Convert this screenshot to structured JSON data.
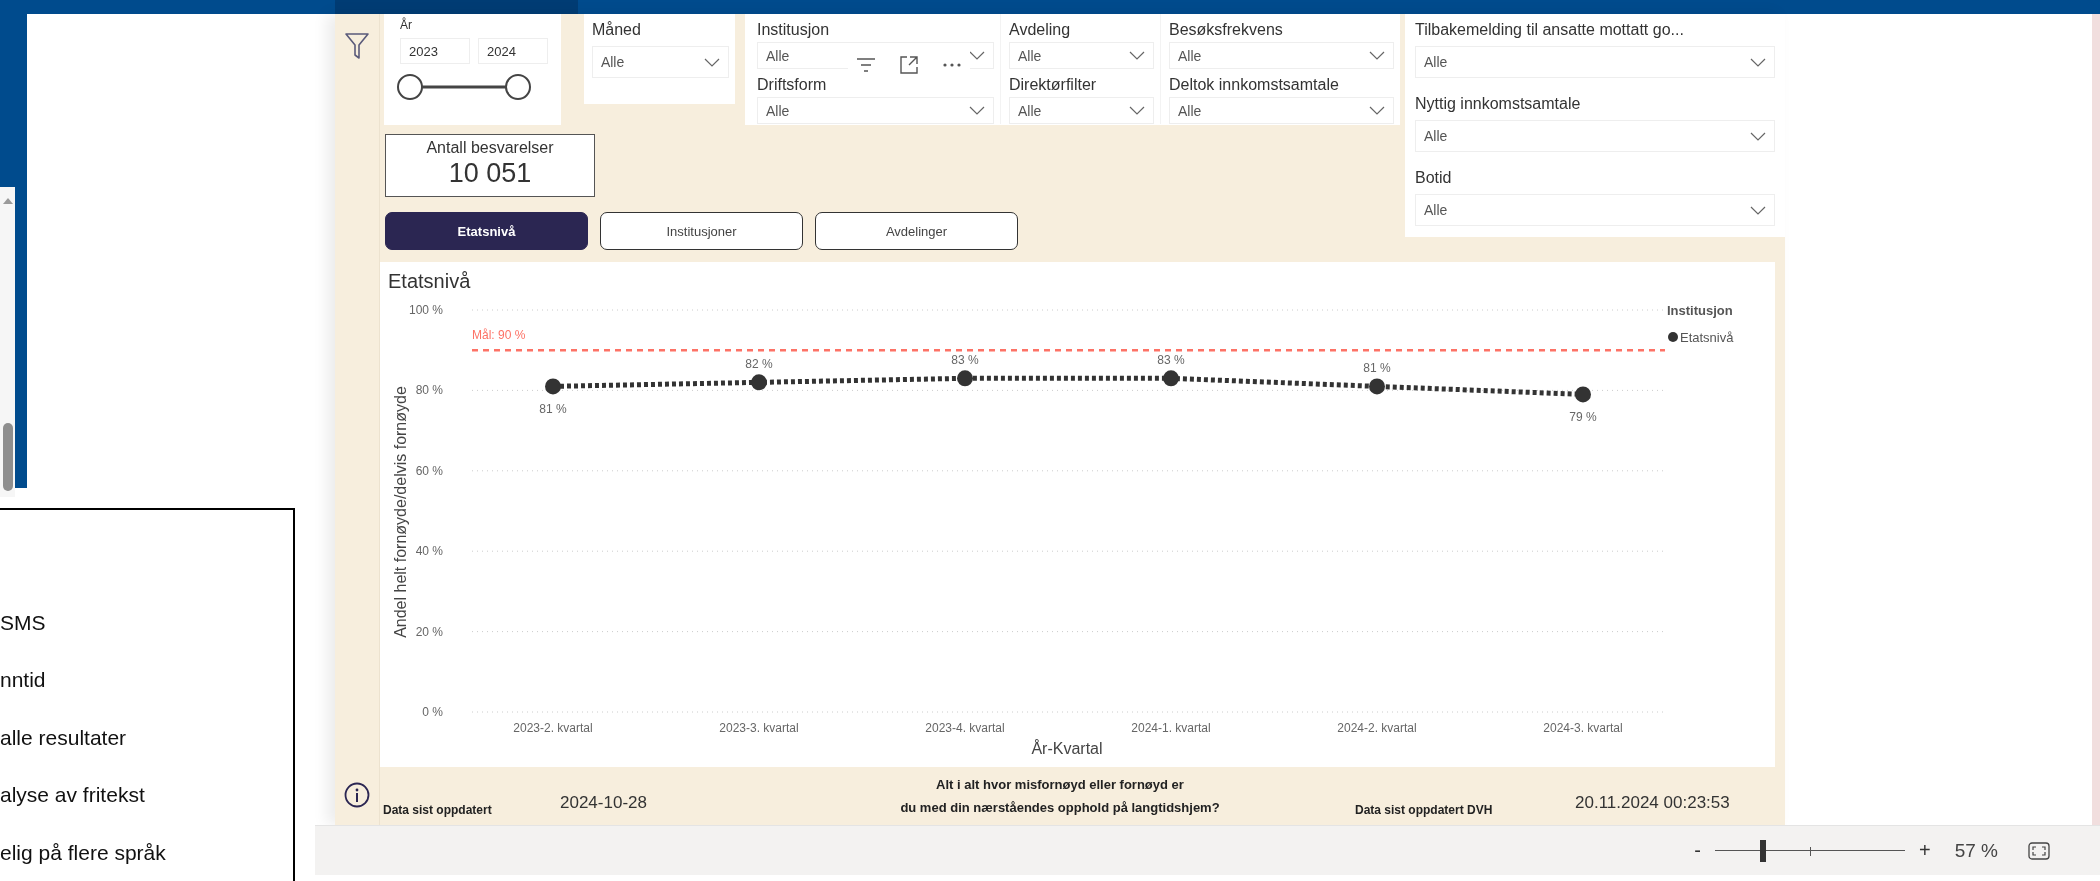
{
  "left_panel": {
    "lines": [
      "SMS",
      "nntid",
      "alle resultater",
      "alyse av fritekst",
      "elig på flere språk"
    ]
  },
  "report": {
    "year_slicer": {
      "label": "År",
      "from": "2023",
      "to": "2024",
      "level": 1
    },
    "slicers": [
      {
        "label": "Måned",
        "value": "Alle"
      },
      {
        "label": "Institusjon",
        "value": "Alle"
      },
      {
        "label": "Avdeling",
        "value": "Alle"
      },
      {
        "label": "Besøksfrekvens",
        "value": "Alle"
      },
      {
        "label": "Tilbakemelding til ansatte mottatt go...",
        "value": "Alle"
      },
      {
        "label": "Driftsform",
        "value": "Alle"
      },
      {
        "label": "Direktørfilter",
        "value": "Alle"
      },
      {
        "label": "Deltok innkomstsamtale",
        "value": "Alle"
      },
      {
        "label": "Nyttig innkomstsamtale",
        "value": "Alle"
      },
      {
        "label": "Botid",
        "value": "Alle"
      }
    ],
    "card": {
      "label": "Antall besvarelser",
      "value": "10 051"
    },
    "view_buttons": [
      {
        "label": "Etatsnivå",
        "selected": true
      },
      {
        "label": "Institusjoner",
        "selected": false
      },
      {
        "label": "Avdelinger",
        "selected": false
      }
    ],
    "chart": {
      "legend_title": "Institusjon",
      "chart_data": {
        "type": "line",
        "title": "Etatsnivå",
        "xlabel": "År-Kvartal",
        "ylabel": "Andel helt fornøyde/delvis fornøyde",
        "categories": [
          "2023-2. kvartal",
          "2023-3. kvartal",
          "2023-4. kvartal",
          "2024-1. kvartal",
          "2024-2. kvartal",
          "2024-3. kvartal"
        ],
        "series": [
          {
            "name": "Etatsnivå",
            "color": "#333333",
            "line_style": "dotted",
            "marker": "circle",
            "values": [
              81,
              82,
              83,
              83,
              81,
              79
            ]
          }
        ],
        "ylim": [
          0,
          100
        ],
        "yticks": [
          {
            "value": 0,
            "label": "0 %"
          },
          {
            "value": 20,
            "label": "20 %"
          },
          {
            "value": 40,
            "label": "40 %"
          },
          {
            "value": 60,
            "label": "60 %"
          },
          {
            "value": 80,
            "label": "80 %"
          },
          {
            "value": 100,
            "label": "100 %"
          }
        ],
        "value_labels": [
          "81 %",
          "82 %",
          "83 %",
          "83 %",
          "81 %",
          "79 %"
        ],
        "grid": true,
        "ref_lines": [
          {
            "axis": "y",
            "value": 90,
            "label": "Mål: 90 %",
            "color": "#fd7266"
          }
        ]
      }
    },
    "footer": {
      "updated_label": "Data sist oppdatert",
      "updated": "2024-10-28",
      "question_lines": [
        "Alt i alt hvor misfornøyd eller fornøyd er",
        "du med din nærståendes opphold på langtidshjem?"
      ],
      "dvh_label": "Data sist oppdatert DVH",
      "dvh_updated": "20.11.2024 00:23:53"
    }
  },
  "zoom_bar": {
    "minus": "-",
    "plus": "+",
    "level": 0.25,
    "percent": "57 %"
  }
}
